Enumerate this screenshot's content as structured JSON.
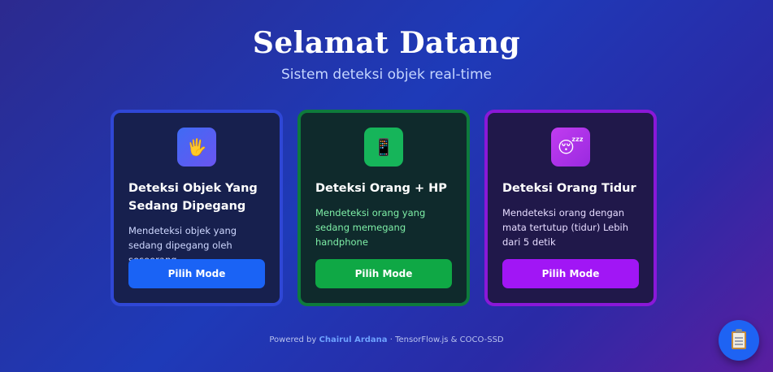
{
  "header": {
    "title": "Selamat Datang",
    "subtitle": "Sistem deteksi objek real-time"
  },
  "cards": [
    {
      "icon": "raised-hand-icon",
      "icon_glyph": "🖐",
      "title": "Deteksi Objek Yang Sedang Dipegang",
      "description": "Mendeteksi objek yang sedang dipegang oleh seseorang",
      "button_label": "Pilih Mode",
      "accent": "#1a63f5"
    },
    {
      "icon": "mobile-phone-icon",
      "icon_glyph": "📱",
      "title": "Deteksi Orang + HP",
      "description": "Mendeteksi orang yang sedang memegang handphone",
      "button_label": "Pilih Mode",
      "accent": "#0fa845"
    },
    {
      "icon": "sleeping-face-icon",
      "icon_glyph": "😴",
      "title": "Deteksi Orang Tidur",
      "description": "Mendeteksi orang dengan mata tertutup (tidur) Lebih dari 5 detik",
      "button_label": "Pilih Mode",
      "accent": "#a116f5"
    }
  ],
  "footer": {
    "prefix": "Powered by ",
    "author": "Chairul Ardana",
    "suffix": " · TensorFlow.js & COCO-SSD"
  },
  "fab": {
    "icon": "clipboard-icon"
  }
}
